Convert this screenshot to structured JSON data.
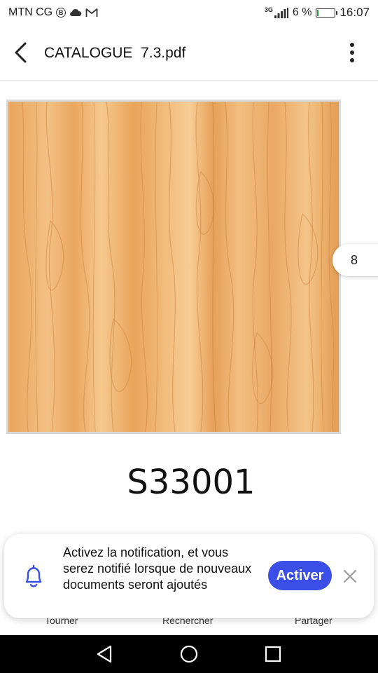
{
  "status_bar": {
    "carrier": "MTN CG",
    "network": "3G",
    "battery_text": "6 %",
    "battery_level": 0.06,
    "time": "16:07",
    "icons": [
      "b-circle-icon",
      "cloud-icon",
      "gmail-icon",
      "signal-icon",
      "battery-icon"
    ]
  },
  "header": {
    "title": "CATALOGUE  7.3.pdf",
    "back_icon": "back-arrow-icon",
    "menu_icon": "more-vertical-icon"
  },
  "document": {
    "page_number": "8",
    "product_code": "S33001",
    "texture": "light-oak-wood-grain"
  },
  "toolbar": {
    "rotate_label": "Tourner",
    "search_label": "Rechercher",
    "share_label": "Partager"
  },
  "notification": {
    "message": "Activez la notification, et vous serez notifié lorsque de nouveaux documents seront ajoutés",
    "button_label": "Activer",
    "accent": "#3b4ee6"
  },
  "nav_bar": {
    "icons": [
      "nav-back-icon",
      "nav-home-icon",
      "nav-recents-icon"
    ]
  }
}
